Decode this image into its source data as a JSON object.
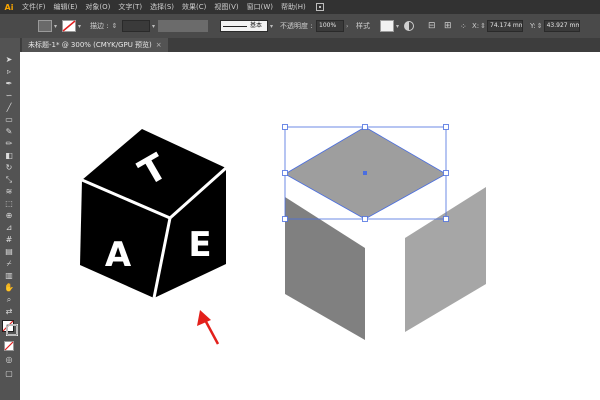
{
  "app": {
    "logo_text": "Ai"
  },
  "menu": {
    "items": [
      "文件(F)",
      "编辑(E)",
      "对象(O)",
      "文字(T)",
      "选择(S)",
      "效果(C)",
      "视图(V)",
      "窗口(W)",
      "帮助(H)"
    ]
  },
  "controlbar": {
    "fill_color": "#4a4a4a",
    "stroke_label": "描边 :",
    "stroke_style_label": "基本",
    "opacity_label": "不透明度 :",
    "opacity_value": "100%",
    "style_label": "样式",
    "x_label": "X:",
    "x_value": "74.174 mm",
    "y_label": "Y:",
    "y_value": "43.927 mm"
  },
  "document": {
    "tab_title": "未标题-1* @ 300% (CMYK/GPU 预览)",
    "close_icon": "close-icon"
  },
  "tools": [
    "selection-tool-icon",
    "direct-selection-tool-icon",
    "pen-tool-icon",
    "curvature-tool-icon",
    "line-tool-icon",
    "rectangle-tool-icon",
    "paintbrush-tool-icon",
    "pencil-tool-icon",
    "eraser-tool-icon",
    "rotate-tool-icon",
    "scale-tool-icon",
    "warp-tool-icon",
    "free-transform-tool-icon",
    "shape-builder-tool-icon",
    "perspective-grid-tool-icon",
    "mesh-tool-icon",
    "gradient-tool-icon",
    "eyedropper-tool-icon",
    "blend-tool-icon",
    "symbol-sprayer-tool-icon",
    "column-graph-tool-icon",
    "artboard-tool-icon",
    "slice-tool-icon",
    "hand-tool-icon",
    "zoom-tool-icon"
  ],
  "artwork": {
    "cube_letters": {
      "top": "T",
      "left": "A",
      "right": "E"
    },
    "colors": {
      "cube_black": "#000000",
      "diamond_gray": "#9e9e9e",
      "left_face_gray": "#808080",
      "right_face_gray": "#a6a6a6",
      "selection_blue": "#4a6ee0",
      "arrow_red": "#e3201b"
    }
  }
}
